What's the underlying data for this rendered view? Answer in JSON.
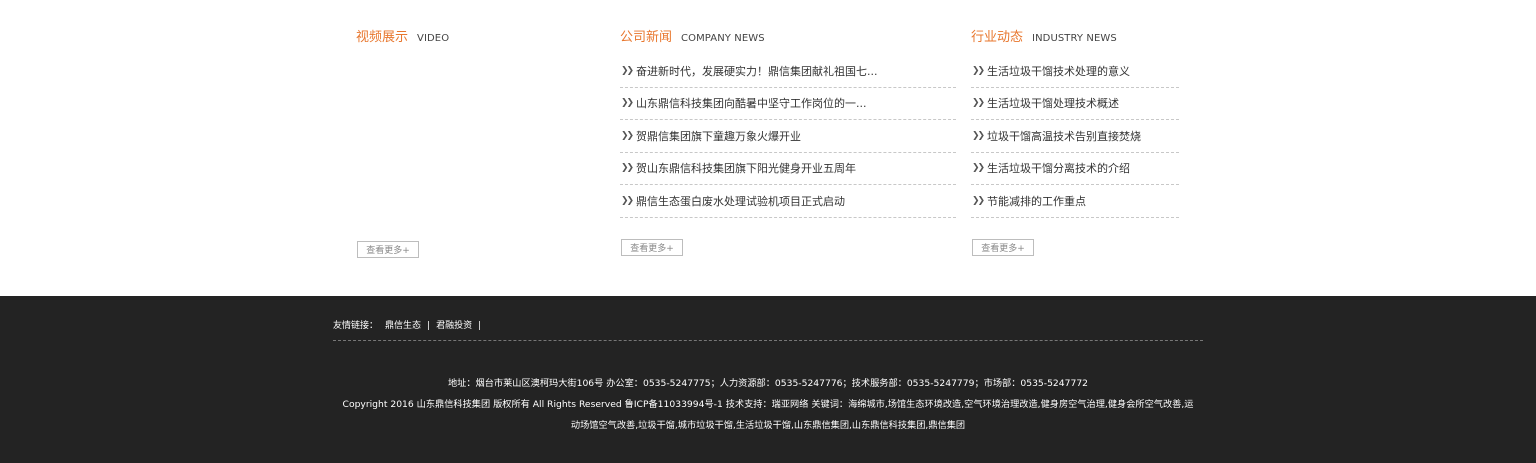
{
  "video": {
    "title": "视频展示",
    "subtitle": "VIDEO",
    "more": "查看更多+"
  },
  "company_news": {
    "title": "公司新闻",
    "subtitle": "COMPANY NEWS",
    "items": [
      "奋进新时代，发展硬实力！鼎信集团献礼祖国七...",
      "山东鼎信科技集团向酷暑中坚守工作岗位的一...",
      "贺鼎信集团旗下童趣万象火爆开业",
      "贺山东鼎信科技集团旗下阳光健身开业五周年",
      "鼎信生态蛋白废水处理试验机项目正式启动"
    ],
    "more": "查看更多+"
  },
  "industry_news": {
    "title": "行业动态",
    "subtitle": "INDUSTRY NEWS",
    "items": [
      "生活垃圾干馏技术处理的意义",
      "生活垃圾干馏处理技术概述",
      "垃圾干馏高温技术告别直接焚烧",
      "生活垃圾干馏分离技术的介绍",
      "节能减排的工作重点"
    ],
    "more": "查看更多+"
  },
  "footer": {
    "links_label": "友情链接：",
    "links": [
      "鼎信生态",
      "君融投资"
    ],
    "separator": "|",
    "address": "地址：烟台市莱山区澳柯玛大街106号 办公室：0535-5247775；人力资源部：0535-5247776；技术服务部：0535-5247779；市场部：0535-5247772",
    "copyright_line1": "Copyright 2016 山东鼎信科技集团 版权所有 All Rights Reserved 鲁ICP备11033994号-1 技术支持：瑞亚网络 关键词：海绵城市,场馆生态环境改造,空气环境治理改造,健身房空气治理,健身会所空气改善,运",
    "copyright_line2": "动场馆空气改善,垃圾干馏,城市垃圾干馏,生活垃圾干馏,山东鼎信集团,山东鼎信科技集团,鼎信集团"
  },
  "colors": {
    "accent": "#e8772e",
    "footer_bg": "#232323"
  },
  "icons": {
    "list_bullet": "double-chevron-right-icon"
  }
}
